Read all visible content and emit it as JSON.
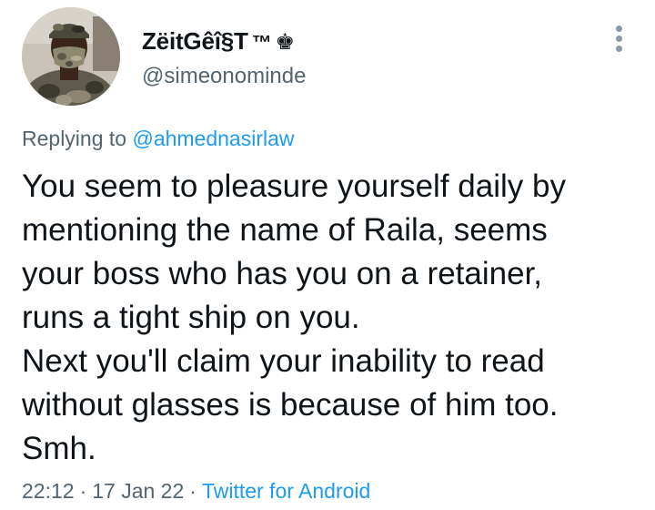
{
  "user": {
    "display_name": "ZëitGêî§T",
    "tm": "™",
    "crown": "♚",
    "handle": "@simeonominde",
    "avatar_icon": "profile-photo-camouflage-mask"
  },
  "reply": {
    "prefix": "Replying to",
    "mention": "@ahmednasirlaw"
  },
  "tweet": {
    "lines": [
      "You seem to pleasure yourself daily by",
      "mentioning the name of Raila, seems",
      "your boss who has you on a retainer,",
      "runs a tight ship on you.",
      "Next you'll claim your inability to read",
      "without glasses is because of him too.",
      "Smh."
    ]
  },
  "meta": {
    "time": "22:12",
    "separator": "·",
    "date": "17 Jan 22",
    "source": "Twitter for Android"
  },
  "colors": {
    "text": "#0f1419",
    "secondary": "#536471",
    "link": "#1d9bf0",
    "more_icon": "#8b98a5"
  }
}
